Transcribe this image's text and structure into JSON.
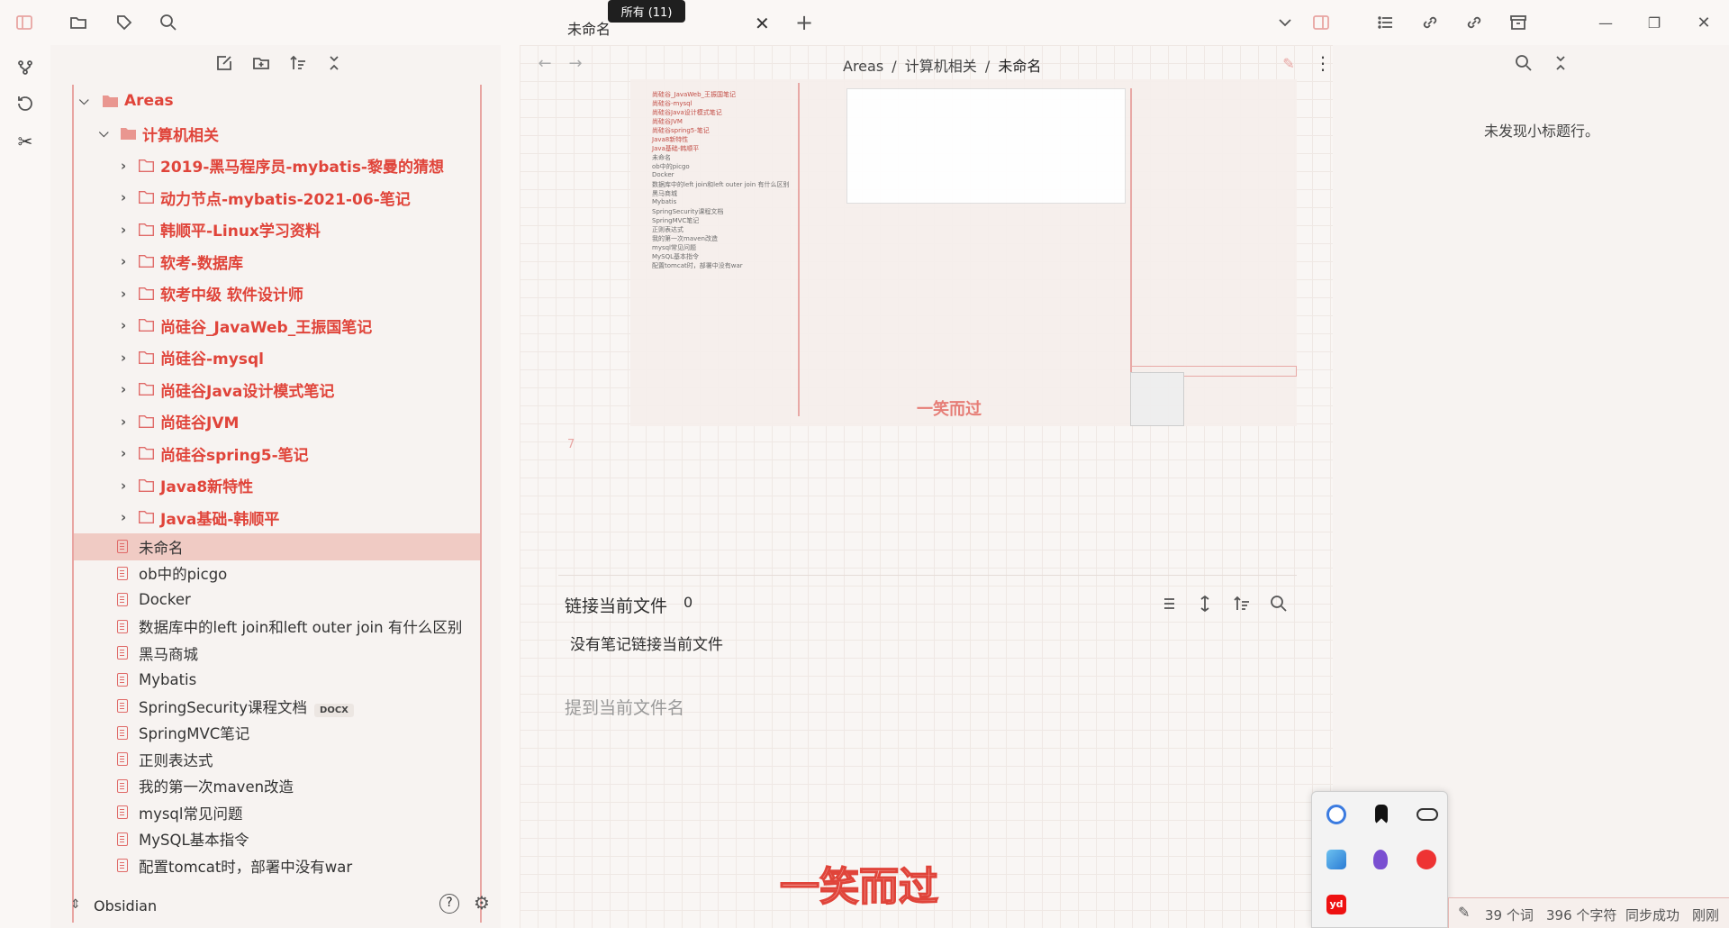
{
  "titlebar": {
    "tab_title": "未命名",
    "tooltip": "所有 (11)"
  },
  "sidebar": {
    "root": "Areas",
    "sub": "计算机相关",
    "folders": [
      "2019-黑马程序员-mybatis-黎曼的猜想",
      "动力节点-mybatis-2021-06-笔记",
      "韩顺平-Linux学习资料",
      "软考-数据库",
      "软考中级 软件设计师",
      "尚硅谷_JavaWeb_王振国笔记",
      "尚硅谷-mysql",
      "尚硅谷Java设计模式笔记",
      "尚硅谷JVM",
      "尚硅谷spring5-笔记",
      "Java8新特性",
      "Java基础-韩顺平"
    ],
    "files": [
      "未命名",
      "ob中的picgo",
      "Docker",
      "数据库中的left join和left outer join 有什么区别",
      "黑马商城",
      "Mybatis",
      "SpringSecurity课程文档",
      "SpringMVC笔记",
      "正则表达式",
      "我的第一次maven改造",
      "mysql常见问题",
      "MySQL基本指令",
      "配置tomcat时，部署中没有war"
    ],
    "docx_badge": "DOCX",
    "vault": "Obsidian"
  },
  "main": {
    "breadcrumb": {
      "p1": "Areas",
      "sep": "/",
      "p2": "计算机相关",
      "p3": "未命名"
    },
    "line_number": "7",
    "backlinks": {
      "title": "链接当前文件",
      "count": "0",
      "empty": "没有笔记链接当前文件",
      "mentions": "提到当前文件名"
    },
    "watermark": "一笑而过"
  },
  "right": {
    "empty": "未发现小标题行。"
  },
  "status": {
    "words": "39 个词",
    "chars": "396 个字符",
    "sync": "同步成功",
    "time": "刚刚"
  },
  "colors": {
    "accent": "#e0443a",
    "active_bg": "#f0cbc4"
  }
}
